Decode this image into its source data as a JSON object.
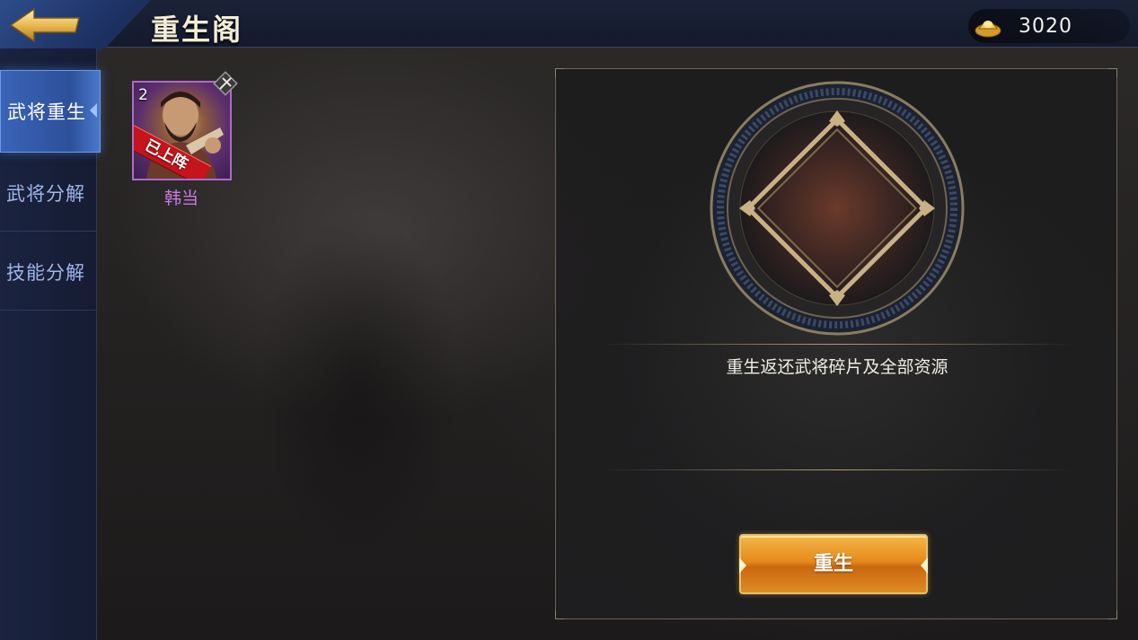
{
  "header": {
    "title": "重生阁",
    "currency": {
      "icon": "gold-ingot-icon",
      "value": "3020"
    }
  },
  "sidebar": {
    "items": [
      {
        "label": "武将重生",
        "active": true
      },
      {
        "label": "武将分解",
        "active": false
      },
      {
        "label": "技能分解",
        "active": false
      }
    ]
  },
  "hero": {
    "level": "2",
    "badge": "已上阵",
    "name": "韩当",
    "rarity_color": "#b06ac8"
  },
  "panel": {
    "description": "重生返还武将碎片及全部资源",
    "button_label": "重生"
  },
  "colors": {
    "accent_blue": "#3a64b8",
    "button_gold": "#e68a1c",
    "hero_name": "#c67ae0"
  }
}
